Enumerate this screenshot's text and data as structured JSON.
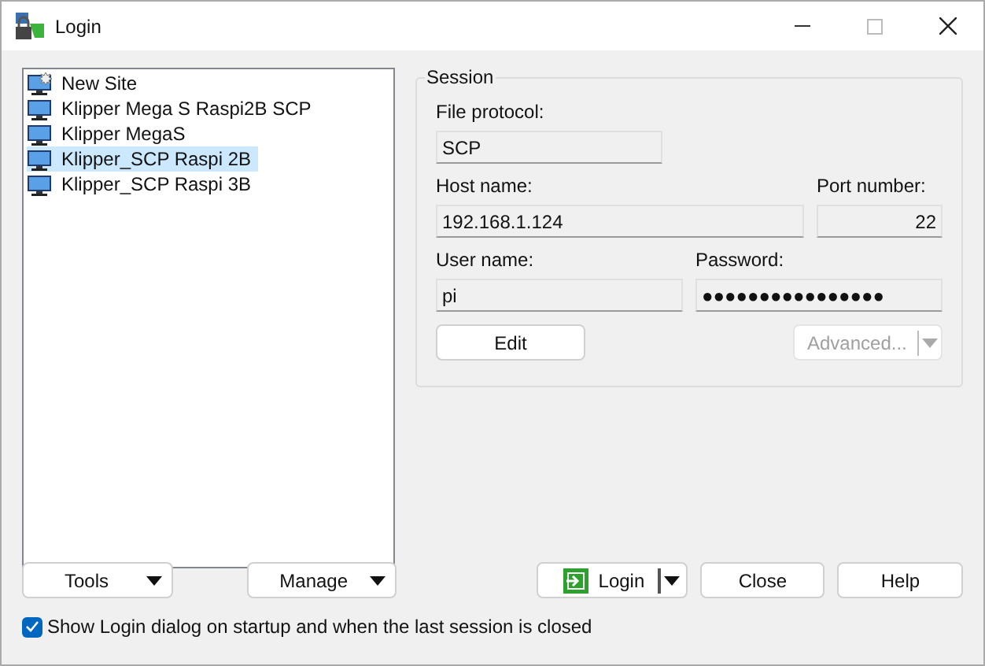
{
  "window": {
    "title": "Login"
  },
  "sites": [
    {
      "label": "New Site",
      "kind": "new",
      "selected": false
    },
    {
      "label": "Klipper Mega S Raspi2B SCP",
      "kind": "site",
      "selected": false
    },
    {
      "label": "Klipper MegaS",
      "kind": "site",
      "selected": false
    },
    {
      "label": "Klipper_SCP Raspi 2B",
      "kind": "site",
      "selected": true
    },
    {
      "label": "Klipper_SCP Raspi 3B",
      "kind": "site",
      "selected": false
    }
  ],
  "session": {
    "title": "Session",
    "file_protocol": {
      "label": "File protocol:",
      "value": "SCP"
    },
    "host_name": {
      "label": "Host name:",
      "value": "192.168.1.124"
    },
    "port_number": {
      "label": "Port number:",
      "value": "22"
    },
    "user_name": {
      "label": "User name:",
      "value": "pi"
    },
    "password": {
      "label": "Password:",
      "value": "●●●●●●●●●●●●●●●●"
    },
    "edit_button": "Edit",
    "advanced_button": {
      "label": "Advanced...",
      "disabled": true
    }
  },
  "tools_button": "Tools",
  "manage_button": "Manage",
  "login_button": "Login",
  "close_button": "Close",
  "help_button": "Help",
  "startup_checkbox": {
    "label": "Show Login dialog on startup and when the last session is closed",
    "checked": true
  }
}
